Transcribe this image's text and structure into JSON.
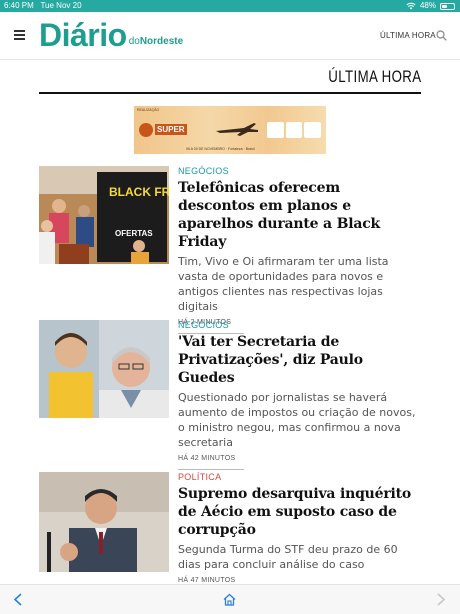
{
  "status_bar": {
    "time": "6:40 PM",
    "date": "Tue Nov 20",
    "battery_text": "48%",
    "battery_level": 0.48
  },
  "nav": {
    "logo_main": "Diário",
    "logo_prefix": "do",
    "logo_suffix": "Nordeste",
    "menu_icon": "hamburger-icon",
    "ultima_hora_link": "ÚLTIMA HORA",
    "search_icon": "search-icon"
  },
  "section": {
    "title": "ÚLTIMA HORA"
  },
  "ad": {
    "top_text": "REALIZAÇÃO",
    "brand": "SUPER",
    "dates": "06 A 09 DE NOVEMBRO · Fortaleza · Brasil"
  },
  "articles": [
    {
      "kicker": "NEGÓCIOS",
      "headline": "Telefônicas oferecem descontos em planos e aparelhos durante a Black Friday",
      "summary": "Tim, Vivo e Oi afirmaram ter uma lista vasta de oportunidades para novos e antigos clientes nas respectivas lojas digitais",
      "time": "HÁ 2 MINUTOS",
      "image_banner": "BLACK FRIDAY",
      "image_sub": "OFERTAS"
    },
    {
      "kicker": "NEGÓCIOS",
      "headline": "'Vai ter Secretaria de Privatizações', diz Paulo Guedes",
      "summary": "Questionado por jornalistas se haverá aumento de impostos ou criação de novos, o ministro negou, mas confirmou a nova secretaria",
      "time": "HÁ 42 MINUTOS"
    },
    {
      "kicker": "POLÍTICA",
      "headline": "Supremo desarquiva inquérito de Aécio em suposto caso de corrupção",
      "summary": "Segunda Turma do STF deu prazo de 60 dias para concluir análise do caso",
      "time": "HÁ 47 MINUTOS"
    }
  ],
  "bottom_bar": {
    "back_icon": "back-arrow-icon",
    "home_icon": "home-icon",
    "forward_icon": "forward-arrow-icon"
  },
  "colors": {
    "brand_teal": "#1f9d8f",
    "status_bar": "#26a9a0",
    "kicker_blue": "#1a9aa8",
    "kicker_red": "#d14b3c"
  }
}
